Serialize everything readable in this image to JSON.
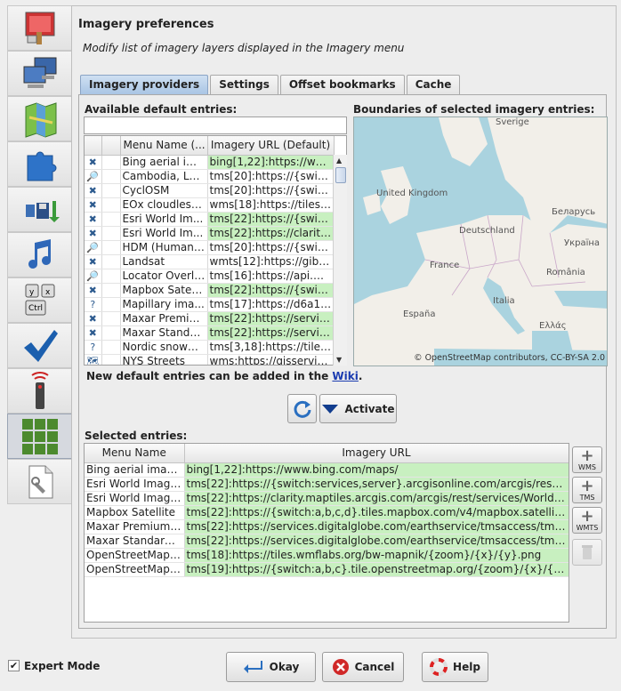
{
  "header": {
    "title": "Imagery preferences",
    "subtitle": "Modify list of imagery layers displayed in the Imagery menu"
  },
  "tabs": [
    "Imagery providers",
    "Settings",
    "Offset bookmarks",
    "Cache"
  ],
  "available": {
    "label": "Available default entries:",
    "filter_value": "",
    "columns": [
      "Menu Name (...",
      "Imagery URL (Default)"
    ],
    "rows": [
      {
        "icon": "wrench-cross-icon",
        "glyph": "✖",
        "name": "Bing aerial im...",
        "url": "bing[1,22]:https://www....",
        "green": true
      },
      {
        "icon": "magnify-icon",
        "glyph": "🔎",
        "name": "Cambodia, La...",
        "url": "tms[20]:https://{switch:...",
        "green": false
      },
      {
        "icon": "wrench-cross-icon",
        "glyph": "✖",
        "name": "CyclOSM",
        "url": "tms[20]:https://{switch:...",
        "green": false
      },
      {
        "icon": "wrench-cross-icon",
        "glyph": "✖",
        "name": "EOx cloudless ...",
        "url": "wms[18]:https://tiles.m...",
        "green": false
      },
      {
        "icon": "wrench-cross-icon",
        "glyph": "✖",
        "name": "Esri World Im...",
        "url": "tms[22]:https://{switch:...",
        "green": true
      },
      {
        "icon": "wrench-cross-icon",
        "glyph": "✖",
        "name": "Esri World Im...",
        "url": "tms[22]:https://clarity....",
        "green": true
      },
      {
        "icon": "magnify-icon",
        "glyph": "🔎",
        "name": "HDM (Humani...",
        "url": "tms[20]:https://{switch:...",
        "green": false
      },
      {
        "icon": "wrench-cross-icon",
        "glyph": "✖",
        "name": "Landsat",
        "url": "wmts[12]:https://gibs.e...",
        "green": false
      },
      {
        "icon": "magnify-icon",
        "glyph": "🔎",
        "name": "Locator Overlay",
        "url": "tms[16]:https://api.ma...",
        "green": false
      },
      {
        "icon": "wrench-cross-icon",
        "glyph": "✖",
        "name": "Mapbox Satell...",
        "url": "tms[22]:https://{switch:...",
        "green": true
      },
      {
        "icon": "question-icon",
        "glyph": "?",
        "name": "Mapillary ima...",
        "url": "tms[17]:https://d6a1v2...",
        "green": false
      },
      {
        "icon": "wrench-cross-icon",
        "glyph": "✖",
        "name": "Maxar Premiu...",
        "url": "tms[22]:https://service...",
        "green": true
      },
      {
        "icon": "wrench-cross-icon",
        "glyph": "✖",
        "name": "Maxar Standa...",
        "url": "tms[22]:https://service...",
        "green": true
      },
      {
        "icon": "question-icon",
        "glyph": "?",
        "name": "Nordic snowm...",
        "url": "tms[3,18]:https://tiles.k...",
        "green": false
      },
      {
        "icon": "map-icon",
        "glyph": "🗺",
        "name": "NYS Streets",
        "url": "wms:https://gisservice...",
        "green": false
      }
    ]
  },
  "boundaries_label": "Boundaries of selected imagery entries:",
  "map": {
    "labels": [
      "Sverige",
      "United Kingdom",
      "Беларусь",
      "Deutschland",
      "Україна",
      "France",
      "România",
      "Italia",
      "España",
      "Ελλάς"
    ],
    "attribution": "© OpenStreetMap contributors, CC-BY-SA 2.0"
  },
  "wiki": {
    "prefix": "New default entries can be added in the ",
    "link": "Wiki",
    "suffix": "."
  },
  "buttons": {
    "activate": "Activate",
    "okay": "Okay",
    "cancel": "Cancel",
    "help": "Help"
  },
  "selected": {
    "label": "Selected entries:",
    "columns": [
      "Menu Name",
      "Imagery URL"
    ],
    "rows": [
      {
        "name": "Bing aerial imagery",
        "url": "bing[1,22]:https://www.bing.com/maps/"
      },
      {
        "name": "Esri World Imagery",
        "url": "tms[22]:https://{switch:services,server}.arcgisonline.com/arcgis/rest/servic..."
      },
      {
        "name": "Esri World Imager...",
        "url": "tms[22]:https://clarity.maptiles.arcgis.com/arcgis/rest/services/World_Imag..."
      },
      {
        "name": "Mapbox Satellite",
        "url": "tms[22]:https://{switch:a,b,c,d}.tiles.mapbox.com/v4/mapbox.satellite/{zoo..."
      },
      {
        "name": "Maxar Premium I...",
        "url": "tms[22]:https://services.digitalglobe.com/earthservice/tmsaccess/tms/1.0.0..."
      },
      {
        "name": "Maxar Standard I...",
        "url": "tms[22]:https://services.digitalglobe.com/earthservice/tmsaccess/tms/1.0.0..."
      },
      {
        "name": "OpenStreetMap (...",
        "url": "tms[18]:https://tiles.wmflabs.org/bw-mapnik/{zoom}/{x}/{y}.png"
      },
      {
        "name": "OpenStreetMap C...",
        "url": "tms[19]:https://{switch:a,b,c}.tile.openstreetmap.org/{zoom}/{x}/{y}.png"
      }
    ]
  },
  "side_actions": [
    "WMS",
    "TMS",
    "WMTS"
  ],
  "expert_mode": {
    "label": "Expert Mode",
    "checked": true
  },
  "sidebar_icons": [
    "display-preferences-icon",
    "connection-icon",
    "map-layers-icon",
    "plugins-icon",
    "data-sources-icon",
    "audio-icon",
    "shortcuts-icon",
    "validator-icon",
    "remote-control-icon",
    "imagery-icon",
    "advanced-preferences-icon"
  ],
  "colors": {
    "accent_tab": "#a9c5e4",
    "green_cell": "#c8f0c0",
    "map_sea": "#aad3df",
    "map_land": "#f2efe9"
  }
}
